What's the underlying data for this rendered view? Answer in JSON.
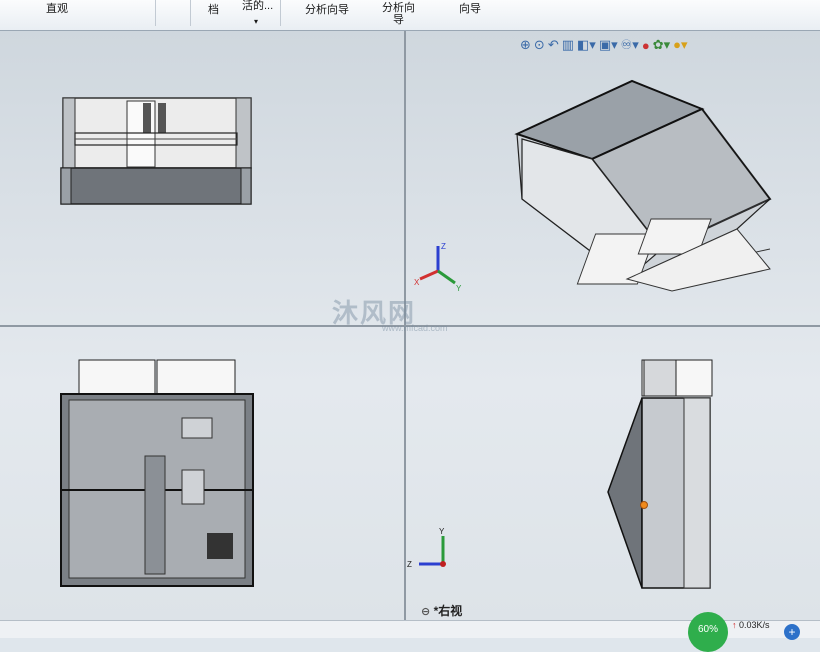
{
  "ribbon": {
    "item1": "直观",
    "item2": "档",
    "item3": "活的...",
    "item4": "分析向导",
    "item5_line1": "分析向",
    "item5_line2": "导",
    "item6": "向导"
  },
  "view_label": "*右视",
  "watermark": "沐风网",
  "watermark_url": "www.mfcad.com",
  "triad": {
    "x": "X",
    "y": "Y",
    "z": "Z"
  },
  "status": {
    "percent": "60%",
    "rate": "0.03K/s"
  },
  "icons": [
    "zoom-fit-icon",
    "zoom-area-icon",
    "previous-view-icon",
    "section-view-icon",
    "view-orientation-icon",
    "display-style-icon",
    "hide-show-icon",
    "appearance-icon",
    "scene-icon",
    "render-icon"
  ]
}
